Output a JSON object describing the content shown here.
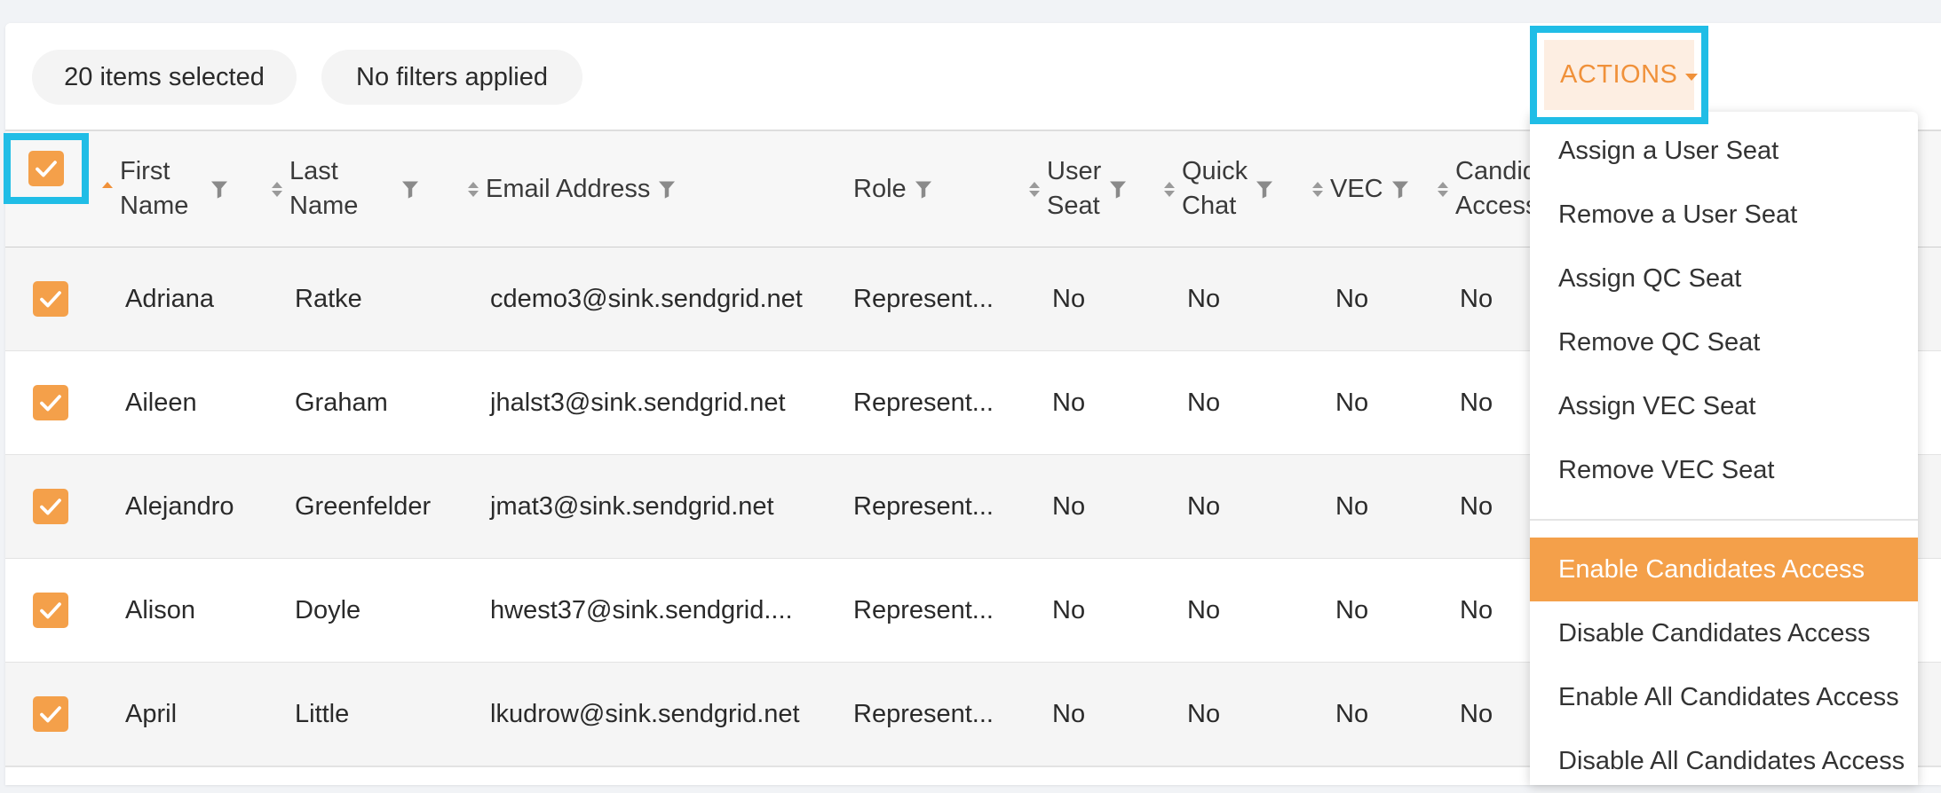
{
  "toolbar": {
    "selected_chip": "20 items selected",
    "filters_chip": "No filters applied",
    "actions_label": "ACTIONS"
  },
  "columns": [
    {
      "line1": "First",
      "line2": "Name"
    },
    {
      "line1": "Last",
      "line2": "Name"
    },
    {
      "line1": "Email Address",
      "line2": ""
    },
    {
      "line1": "Role",
      "line2": ""
    },
    {
      "line1": "User",
      "line2": "Seat"
    },
    {
      "line1": "Quick",
      "line2": "Chat"
    },
    {
      "line1": "VEC",
      "line2": ""
    },
    {
      "line1": "Candid",
      "line2": "Access"
    }
  ],
  "rows": [
    {
      "first": "Adriana",
      "last": "Ratke",
      "email": "cdemo3@sink.sendgrid.net",
      "role": "Represent...",
      "user_seat": "No",
      "quick_chat": "No",
      "vec": "No",
      "cand": "No"
    },
    {
      "first": "Aileen",
      "last": "Graham",
      "email": "jhalst3@sink.sendgrid.net",
      "role": "Represent...",
      "user_seat": "No",
      "quick_chat": "No",
      "vec": "No",
      "cand": "No"
    },
    {
      "first": "Alejandro",
      "last": "Greenfelder",
      "email": "jmat3@sink.sendgrid.net",
      "role": "Represent...",
      "user_seat": "No",
      "quick_chat": "No",
      "vec": "No",
      "cand": "No"
    },
    {
      "first": "Alison",
      "last": "Doyle",
      "email": "hwest37@sink.sendgrid....",
      "role": "Represent...",
      "user_seat": "No",
      "quick_chat": "No",
      "vec": "No",
      "cand": "No"
    },
    {
      "first": "April",
      "last": "Little",
      "email": "lkudrow@sink.sendgrid.net",
      "role": "Represent...",
      "user_seat": "No",
      "quick_chat": "No",
      "vec": "No",
      "cand": "No"
    }
  ],
  "menu": {
    "items": [
      "Assign a User Seat",
      "Remove a User Seat",
      "Assign QC Seat",
      "Remove QC Seat",
      "Assign VEC Seat",
      "Remove VEC Seat",
      "Enable Candidates Access",
      "Disable Candidates Access",
      "Enable All Candidates Access",
      "Disable All Candidates Access"
    ],
    "active_item": "Enable Candidates Access"
  },
  "colors": {
    "accent": "#f4a04a",
    "highlight": "#20bde6"
  }
}
